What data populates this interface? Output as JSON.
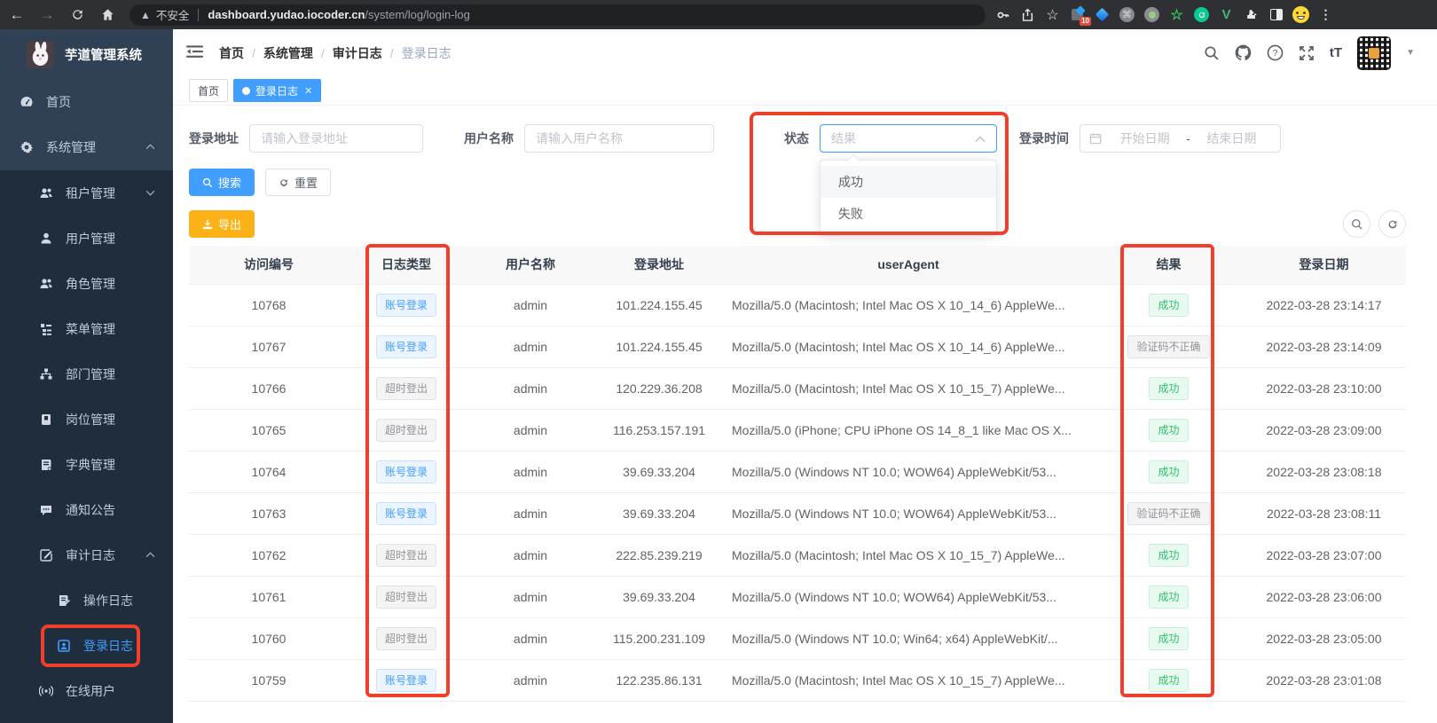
{
  "browser": {
    "security_chip": "不安全",
    "url_domain": "dashboard.yudao.iocoder.cn",
    "url_path": "/system/log/login-log",
    "extension_badge": "10"
  },
  "sidebar": {
    "app_title": "芋道管理系统",
    "items": [
      {
        "label": "首页"
      },
      {
        "label": "系统管理"
      },
      {
        "label": "租户管理"
      },
      {
        "label": "用户管理"
      },
      {
        "label": "角色管理"
      },
      {
        "label": "菜单管理"
      },
      {
        "label": "部门管理"
      },
      {
        "label": "岗位管理"
      },
      {
        "label": "字典管理"
      },
      {
        "label": "通知公告"
      },
      {
        "label": "审计日志"
      },
      {
        "label": "操作日志"
      },
      {
        "label": "登录日志"
      },
      {
        "label": "在线用户"
      }
    ]
  },
  "header": {
    "breadcrumb": [
      "首页",
      "系统管理",
      "审计日志",
      "登录日志"
    ],
    "font_size_icon_text": "tT"
  },
  "tabs": [
    {
      "label": "首页"
    },
    {
      "label": "登录日志"
    }
  ],
  "filters": {
    "address_label": "登录地址",
    "address_placeholder": "请输入登录地址",
    "username_label": "用户名称",
    "username_placeholder": "请输入用户名称",
    "status_label": "状态",
    "status_placeholder": "结果",
    "status_options": [
      "成功",
      "失败"
    ],
    "time_label": "登录时间",
    "time_start_placeholder": "开始日期",
    "time_separator": "-",
    "time_end_placeholder": "结束日期",
    "search_button": "搜索",
    "reset_button": "重置",
    "export_button": "导出"
  },
  "table": {
    "columns": [
      "访问编号",
      "日志类型",
      "用户名称",
      "登录地址",
      "userAgent",
      "结果",
      "登录日期"
    ],
    "rows": [
      {
        "id": "10768",
        "type": "账号登录",
        "type_style": "blue",
        "user": "admin",
        "ip": "101.224.155.45",
        "agent": "Mozilla/5.0 (Macintosh; Intel Mac OS X 10_14_6) AppleWe...",
        "result": "成功",
        "result_style": "green",
        "date": "2022-03-28 23:14:17"
      },
      {
        "id": "10767",
        "type": "账号登录",
        "type_style": "blue",
        "user": "admin",
        "ip": "101.224.155.45",
        "agent": "Mozilla/5.0 (Macintosh; Intel Mac OS X 10_14_6) AppleWe...",
        "result": "验证码不正确",
        "result_style": "grey",
        "date": "2022-03-28 23:14:09"
      },
      {
        "id": "10766",
        "type": "超时登出",
        "type_style": "grey",
        "user": "admin",
        "ip": "120.229.36.208",
        "agent": "Mozilla/5.0 (Macintosh; Intel Mac OS X 10_15_7) AppleWe...",
        "result": "成功",
        "result_style": "green",
        "date": "2022-03-28 23:10:00"
      },
      {
        "id": "10765",
        "type": "超时登出",
        "type_style": "grey",
        "user": "admin",
        "ip": "116.253.157.191",
        "agent": "Mozilla/5.0 (iPhone; CPU iPhone OS 14_8_1 like Mac OS X...",
        "result": "成功",
        "result_style": "green",
        "date": "2022-03-28 23:09:00"
      },
      {
        "id": "10764",
        "type": "账号登录",
        "type_style": "blue",
        "user": "admin",
        "ip": "39.69.33.204",
        "agent": "Mozilla/5.0 (Windows NT 10.0; WOW64) AppleWebKit/53...",
        "result": "成功",
        "result_style": "green",
        "date": "2022-03-28 23:08:18"
      },
      {
        "id": "10763",
        "type": "账号登录",
        "type_style": "blue",
        "user": "admin",
        "ip": "39.69.33.204",
        "agent": "Mozilla/5.0 (Windows NT 10.0; WOW64) AppleWebKit/53...",
        "result": "验证码不正确",
        "result_style": "grey",
        "date": "2022-03-28 23:08:11"
      },
      {
        "id": "10762",
        "type": "超时登出",
        "type_style": "grey",
        "user": "admin",
        "ip": "222.85.239.219",
        "agent": "Mozilla/5.0 (Macintosh; Intel Mac OS X 10_15_7) AppleWe...",
        "result": "成功",
        "result_style": "green",
        "date": "2022-03-28 23:07:00"
      },
      {
        "id": "10761",
        "type": "超时登出",
        "type_style": "grey",
        "user": "admin",
        "ip": "39.69.33.204",
        "agent": "Mozilla/5.0 (Windows NT 10.0; WOW64) AppleWebKit/53...",
        "result": "成功",
        "result_style": "green",
        "date": "2022-03-28 23:06:00"
      },
      {
        "id": "10760",
        "type": "超时登出",
        "type_style": "grey",
        "user": "admin",
        "ip": "115.200.231.109",
        "agent": "Mozilla/5.0 (Windows NT 10.0; Win64; x64) AppleWebKit/...",
        "result": "成功",
        "result_style": "green",
        "date": "2022-03-28 23:05:00"
      },
      {
        "id": "10759",
        "type": "账号登录",
        "type_style": "blue",
        "user": "admin",
        "ip": "122.235.86.131",
        "agent": "Mozilla/5.0 (Macintosh; Intel Mac OS X 10_15_7) AppleWe...",
        "result": "成功",
        "result_style": "green",
        "date": "2022-03-28 23:01:08"
      }
    ]
  },
  "colors": {
    "accent": "#409eff",
    "export_button": "#fcb216",
    "success_tag": "#2fc26e",
    "annotation_red": "#f23f2c",
    "sidebar_bg": "#1f2d3d",
    "sidebar_top_bg": "#304156"
  }
}
